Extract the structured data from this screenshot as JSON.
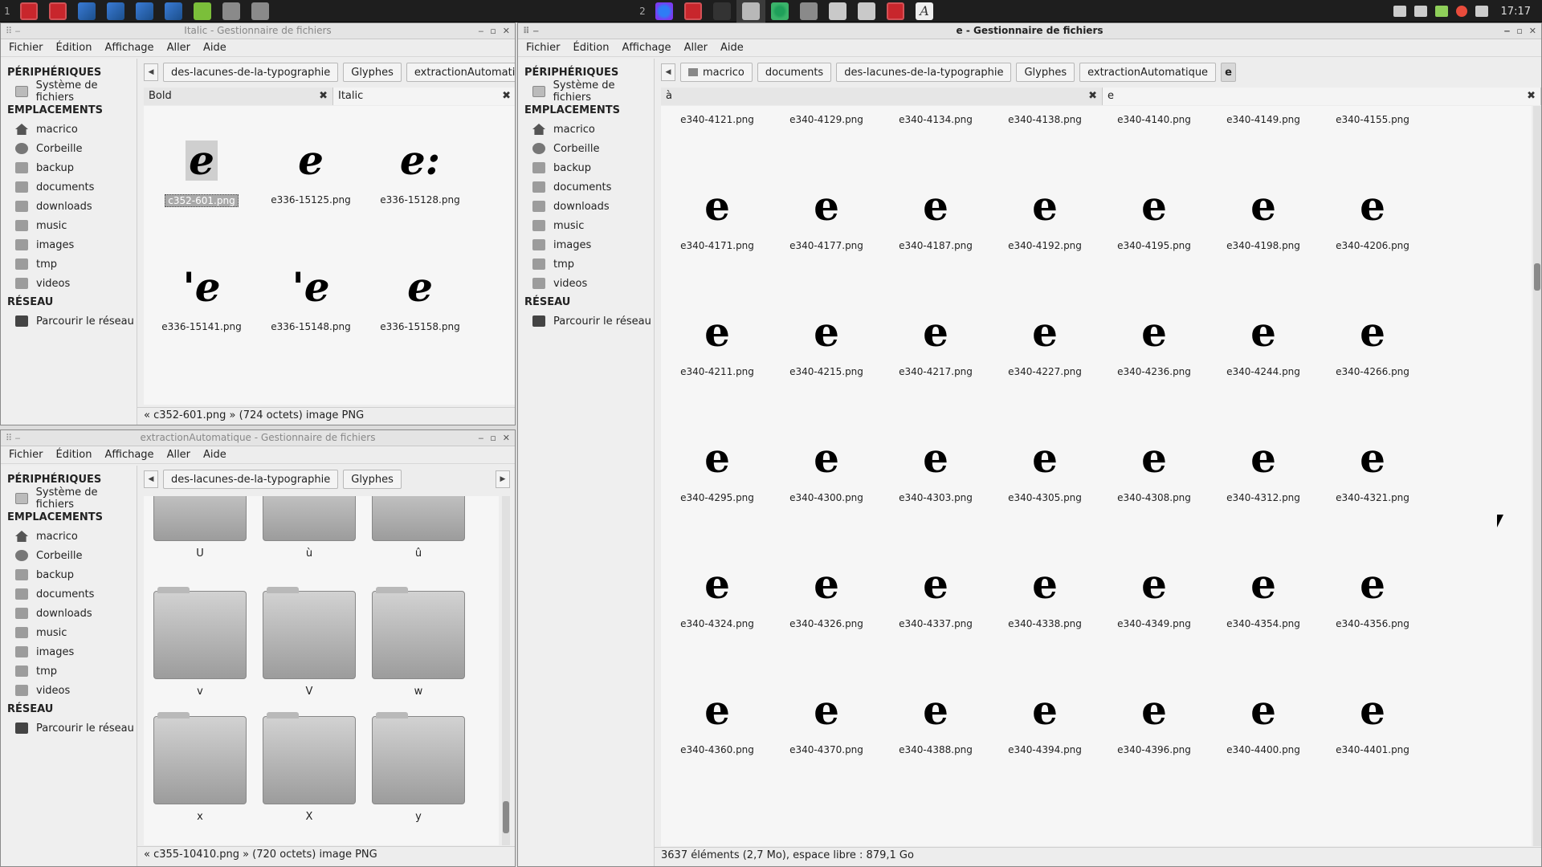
{
  "panel": {
    "workspace1": "1",
    "workspace2": "2",
    "launchers_ws1": [
      "red-app-icon",
      "red-app-icon",
      "blue-feather-icon",
      "blue-feather-icon",
      "blue-feather-icon",
      "blue-feather-icon",
      "green-book-icon",
      "grey-app-icon",
      "grey-app-icon"
    ],
    "launchers_ws2": [
      "firefox-icon",
      "red-app-icon",
      "gimp-icon",
      "folder-icon",
      "chrome-icon",
      "grey-app-icon",
      "folder-icon",
      "folder-icon",
      "red-app-icon",
      "font-icon"
    ],
    "font_glyph": "A",
    "clock": "17:17"
  },
  "windows": {
    "italic": {
      "title": "Italic - Gestionnaire de fichiers",
      "menu": [
        "Fichier",
        "Édition",
        "Affichage",
        "Aller",
        "Aide"
      ],
      "sidebar": {
        "peripherals_head": "PÉRIPHÉRIQUES",
        "peripherals": [
          "Système de fichiers"
        ],
        "places_head": "EMPLACEMENTS",
        "places": [
          "macrico",
          "Corbeille",
          "backup",
          "documents",
          "downloads",
          "music",
          "images",
          "tmp",
          "videos"
        ],
        "network_head": "RÉSEAU",
        "network": [
          "Parcourir le réseau"
        ]
      },
      "crumbs": [
        "des-lacunes-de-la-typographie",
        "Glyphes",
        "extractionAutomatique"
      ],
      "tabs": [
        {
          "label": "Bold"
        },
        {
          "label": "Italic"
        }
      ],
      "files": [
        {
          "name": "c352-601.png",
          "glyph": "e",
          "selected": true
        },
        {
          "name": "e336-15125.png",
          "glyph": "e"
        },
        {
          "name": "e336-15128.png",
          "glyph": "e:"
        },
        {
          "name": "e336-15141.png",
          "glyph": "'e"
        },
        {
          "name": "e336-15148.png",
          "glyph": "'e"
        },
        {
          "name": "e336-15158.png",
          "glyph": "e"
        }
      ],
      "status": "« c352-601.png » (724 octets) image PNG"
    },
    "extraction": {
      "title": "extractionAutomatique - Gestionnaire de fichiers",
      "menu": [
        "Fichier",
        "Édition",
        "Affichage",
        "Aller",
        "Aide"
      ],
      "crumbs": [
        "des-lacunes-de-la-typographie",
        "Glyphes"
      ],
      "folders": [
        "U",
        "ù",
        "û",
        "v",
        "V",
        "w",
        "x",
        "X",
        "y"
      ],
      "status": "« c355-10410.png » (720 octets) image PNG"
    },
    "e": {
      "title": "e - Gestionnaire de fichiers",
      "menu": [
        "Fichier",
        "Édition",
        "Affichage",
        "Aller",
        "Aide"
      ],
      "crumbs": [
        "macrico",
        "documents",
        "des-lacunes-de-la-typographie",
        "Glyphes",
        "extractionAutomatique",
        "e"
      ],
      "tabs": [
        {
          "label": "à"
        },
        {
          "label": "e"
        }
      ],
      "rows": [
        [
          "e340-4121.png",
          "e340-4129.png",
          "e340-4134.png",
          "e340-4138.png",
          "e340-4140.png",
          "e340-4149.png",
          "e340-4155.png"
        ],
        [
          "e340-4171.png",
          "e340-4177.png",
          "e340-4187.png",
          "e340-4192.png",
          "e340-4195.png",
          "e340-4198.png",
          "e340-4206.png"
        ],
        [
          "e340-4211.png",
          "e340-4215.png",
          "e340-4217.png",
          "e340-4227.png",
          "e340-4236.png",
          "e340-4244.png",
          "e340-4266.png"
        ],
        [
          "e340-4295.png",
          "e340-4300.png",
          "e340-4303.png",
          "e340-4305.png",
          "e340-4308.png",
          "e340-4312.png",
          "e340-4321.png"
        ],
        [
          "e340-4324.png",
          "e340-4326.png",
          "e340-4337.png",
          "e340-4338.png",
          "e340-4349.png",
          "e340-4354.png",
          "e340-4356.png"
        ],
        [
          "e340-4360.png",
          "e340-4370.png",
          "e340-4388.png",
          "e340-4394.png",
          "e340-4396.png",
          "e340-4400.png",
          "e340-4401.png"
        ]
      ],
      "glyph": "e",
      "status": "3637 éléments (2,7 Mo), espace libre : 879,1 Go"
    }
  }
}
